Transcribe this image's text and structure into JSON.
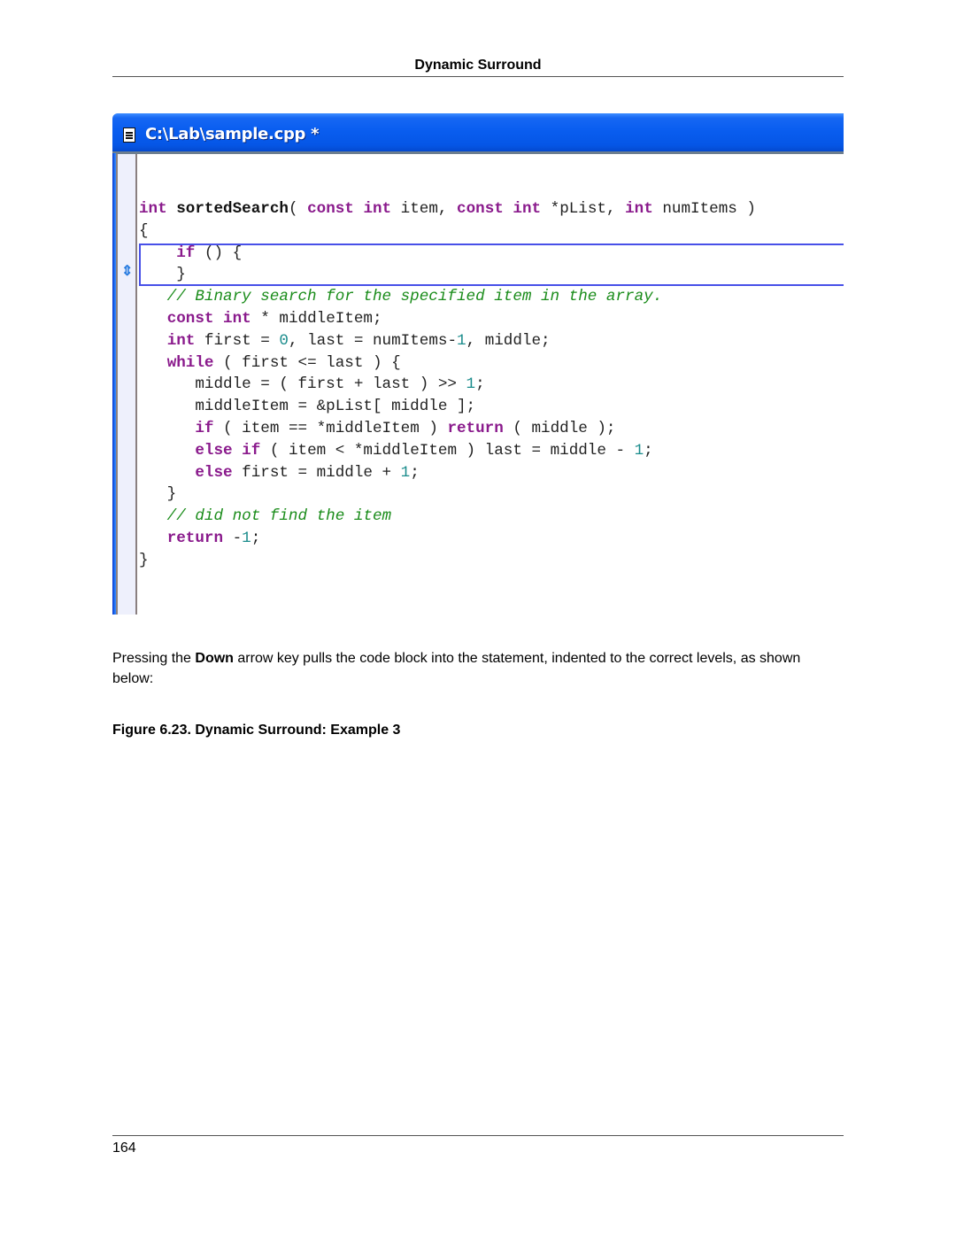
{
  "page": {
    "running_header": "Dynamic Surround",
    "page_number": "164"
  },
  "window": {
    "title": "C:\\Lab\\sample.cpp *",
    "icons": {
      "title_icon": "document-icon",
      "gutter_icon": "up-down-arrow-icon"
    },
    "colors": {
      "titlebar": "#0556e6",
      "keyword": "#8a1a8c",
      "number": "#1a8c8c",
      "comment": "#1a8c1a",
      "surround_box": "#4850e8",
      "gutter": "#eef0fc"
    }
  },
  "code": {
    "lines": [
      [
        {
          "t": "kw",
          "v": "int"
        },
        {
          "t": "p",
          "v": " "
        },
        {
          "t": "fn",
          "v": "sortedSearch"
        },
        {
          "t": "p",
          "v": "( "
        },
        {
          "t": "kw",
          "v": "const"
        },
        {
          "t": "p",
          "v": " "
        },
        {
          "t": "kw",
          "v": "int"
        },
        {
          "t": "p",
          "v": " item, "
        },
        {
          "t": "kw",
          "v": "const"
        },
        {
          "t": "p",
          "v": " "
        },
        {
          "t": "kw",
          "v": "int"
        },
        {
          "t": "p",
          "v": " *pList, "
        },
        {
          "t": "kw",
          "v": "int"
        },
        {
          "t": "p",
          "v": " numItems )"
        }
      ],
      [
        {
          "t": "p",
          "v": "{"
        }
      ],
      [
        {
          "t": "p",
          "v": "    "
        },
        {
          "t": "kw",
          "v": "if"
        },
        {
          "t": "p",
          "v": " () {"
        }
      ],
      [
        {
          "t": "p",
          "v": "    }"
        }
      ],
      [
        {
          "t": "cm",
          "v": "   // Binary search for the specified item in the array."
        }
      ],
      [
        {
          "t": "p",
          "v": "   "
        },
        {
          "t": "kw",
          "v": "const"
        },
        {
          "t": "p",
          "v": " "
        },
        {
          "t": "kw",
          "v": "int"
        },
        {
          "t": "p",
          "v": " * middleItem;"
        }
      ],
      [
        {
          "t": "p",
          "v": "   "
        },
        {
          "t": "kw",
          "v": "int"
        },
        {
          "t": "p",
          "v": " first = "
        },
        {
          "t": "num",
          "v": "0"
        },
        {
          "t": "p",
          "v": ", last = numItems-"
        },
        {
          "t": "num",
          "v": "1"
        },
        {
          "t": "p",
          "v": ", middle;"
        }
      ],
      [
        {
          "t": "p",
          "v": "   "
        },
        {
          "t": "kw",
          "v": "while"
        },
        {
          "t": "p",
          "v": " ( first <= last ) {"
        }
      ],
      [
        {
          "t": "p",
          "v": "      middle = ( first + last ) >> "
        },
        {
          "t": "num",
          "v": "1"
        },
        {
          "t": "p",
          "v": ";"
        }
      ],
      [
        {
          "t": "p",
          "v": "      middleItem = &pList[ middle ];"
        }
      ],
      [
        {
          "t": "p",
          "v": "      "
        },
        {
          "t": "kw",
          "v": "if"
        },
        {
          "t": "p",
          "v": " ( item == *middleItem ) "
        },
        {
          "t": "kw",
          "v": "return"
        },
        {
          "t": "p",
          "v": " ( middle );"
        }
      ],
      [
        {
          "t": "p",
          "v": "      "
        },
        {
          "t": "kw",
          "v": "else"
        },
        {
          "t": "p",
          "v": " "
        },
        {
          "t": "kw",
          "v": "if"
        },
        {
          "t": "p",
          "v": " ( item < *middleItem ) last = middle - "
        },
        {
          "t": "num",
          "v": "1"
        },
        {
          "t": "p",
          "v": ";"
        }
      ],
      [
        {
          "t": "p",
          "v": "      "
        },
        {
          "t": "kw",
          "v": "else"
        },
        {
          "t": "p",
          "v": " first = middle + "
        },
        {
          "t": "num",
          "v": "1"
        },
        {
          "t": "p",
          "v": ";"
        }
      ],
      [
        {
          "t": "p",
          "v": "   }"
        }
      ],
      [
        {
          "t": "cm",
          "v": "   // did not find the item"
        }
      ],
      [
        {
          "t": "p",
          "v": "   "
        },
        {
          "t": "kw",
          "v": "return"
        },
        {
          "t": "p",
          "v": " -"
        },
        {
          "t": "num",
          "v": "1"
        },
        {
          "t": "p",
          "v": ";"
        }
      ],
      [
        {
          "t": "p",
          "v": "}"
        }
      ]
    ]
  },
  "body": {
    "para_before": "Pressing the ",
    "para_bold": "Down",
    "para_after": " arrow key pulls the code block into the statement, indented to the correct levels, as shown below:",
    "caption": "Figure 6.23.  Dynamic Surround: Example 3"
  }
}
